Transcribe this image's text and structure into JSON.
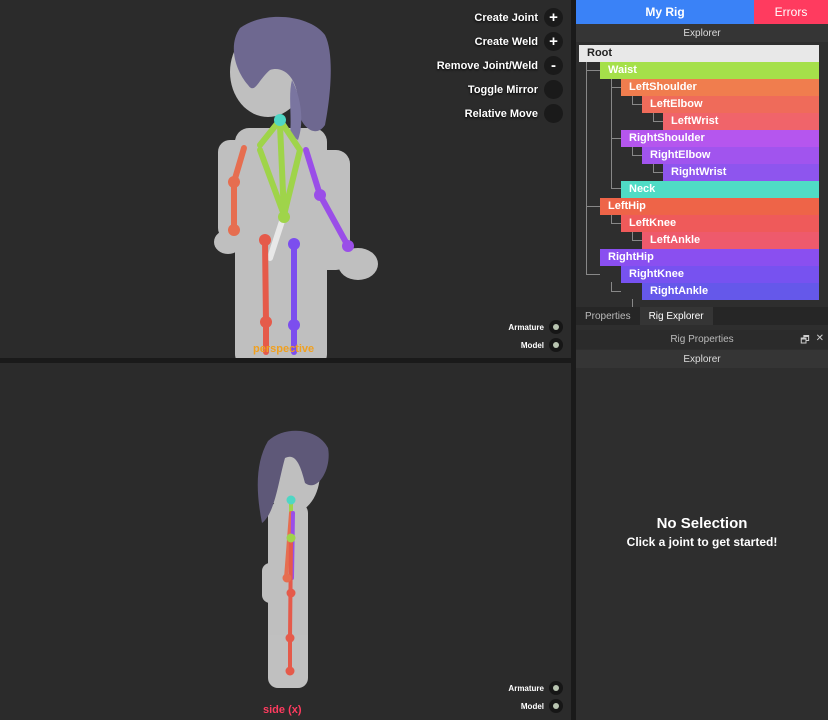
{
  "toolbar": {
    "create_joint": "Create Joint",
    "create_weld": "Create Weld",
    "remove_joint_weld": "Remove Joint/Weld",
    "toggle_mirror": "Toggle Mirror",
    "relative_move": "Relative Move",
    "plus_icon": "+",
    "minus_icon": "-"
  },
  "visibility": {
    "armature": "Armature",
    "model": "Model"
  },
  "views": {
    "top_label": "perspective",
    "bottom_label": "side (x)"
  },
  "tabs": {
    "my_rig": "My Rig",
    "errors": "Errors"
  },
  "explorer": {
    "title": "Explorer",
    "nodes": [
      {
        "label": "Root",
        "color": "#e8e8e8"
      },
      {
        "label": "Waist",
        "color": "#a5e04a"
      },
      {
        "label": "LeftShoulder",
        "color": "#f07d4e"
      },
      {
        "label": "LeftElbow",
        "color": "#ef6b5a"
      },
      {
        "label": "LeftWrist",
        "color": "#f0646a"
      },
      {
        "label": "RightShoulder",
        "color": "#b556ee"
      },
      {
        "label": "RightElbow",
        "color": "#a154ee"
      },
      {
        "label": "RightWrist",
        "color": "#8e55ee"
      },
      {
        "label": "Neck",
        "color": "#4fdcc5"
      },
      {
        "label": "LeftHip",
        "color": "#ee6448"
      },
      {
        "label": "LeftKnee",
        "color": "#ef5a5a"
      },
      {
        "label": "LeftAnkle",
        "color": "#ee5a6c"
      },
      {
        "label": "RightHip",
        "color": "#8a4ff0"
      },
      {
        "label": "RightKnee",
        "color": "#7752f0"
      },
      {
        "label": "RightAnkle",
        "color": "#6558ea"
      }
    ]
  },
  "bottom_tabs": {
    "properties": "Properties",
    "rig_explorer": "Rig Explorer"
  },
  "rig_properties": {
    "title": "Rig Properties",
    "explorer_title": "Explorer",
    "restore_icon": "🗗",
    "close_icon": "✕",
    "no_selection_title": "No Selection",
    "no_selection_sub": "Click a joint to get started!"
  }
}
